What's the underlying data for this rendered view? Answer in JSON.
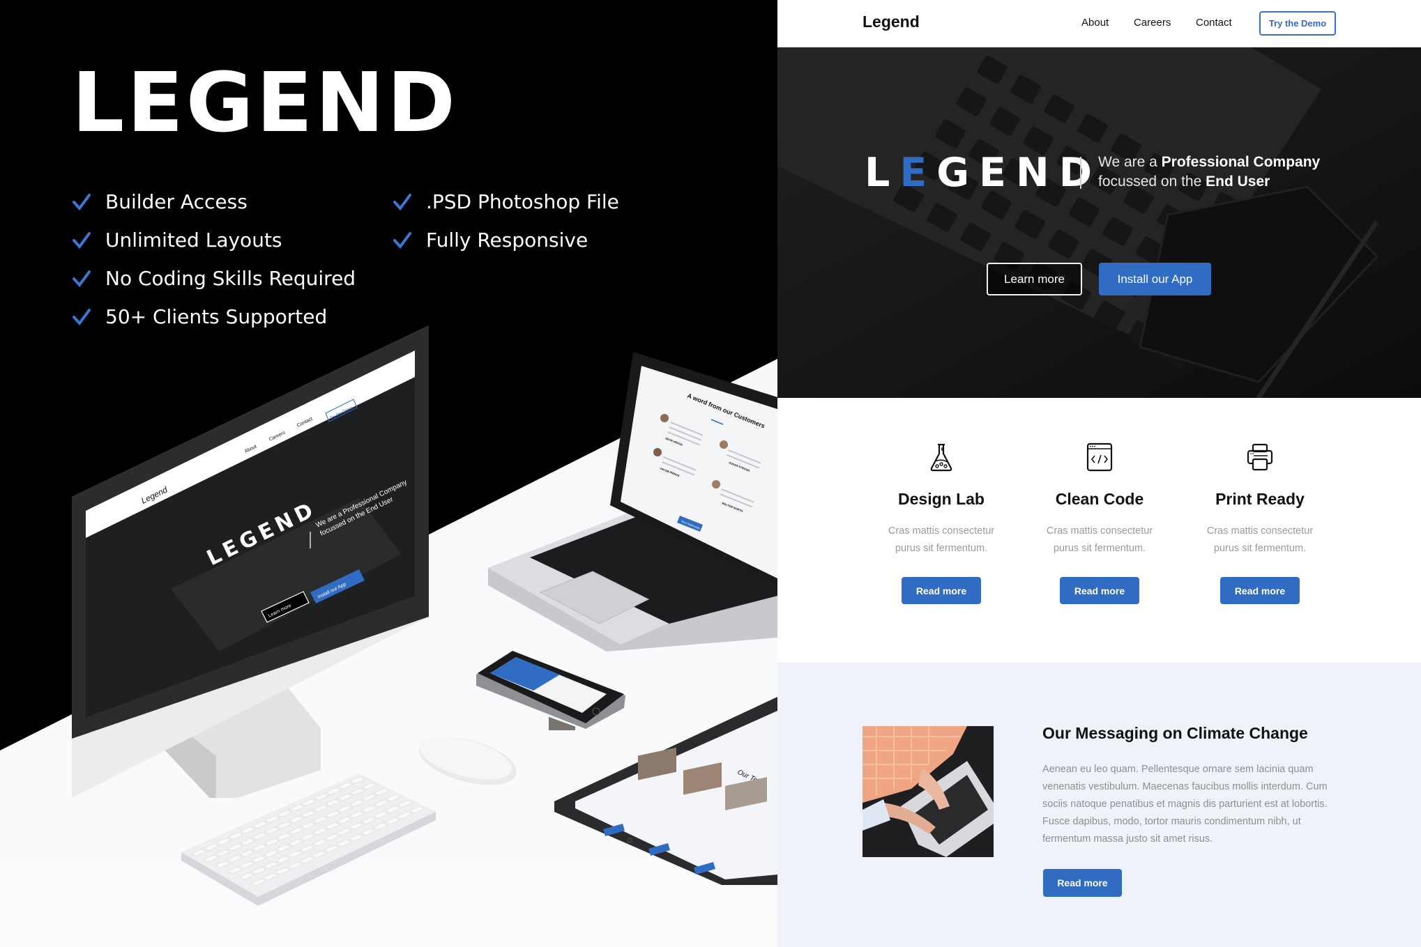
{
  "promo": {
    "title": "LEGEND",
    "features_col1": [
      "Builder Access",
      "Unlimited Layouts",
      "No Coding Skills Required",
      "50+ Clients Supported"
    ],
    "features_col2": [
      ".PSD Photoshop File",
      "Fully Responsive"
    ],
    "check_icon": "checkmark-icon",
    "devices": {
      "imac_screen": {
        "logo": "Legend",
        "nav": [
          "About",
          "Careers",
          "Contact"
        ],
        "demo_button": "Try the Demo",
        "wordmark": "LEGEND",
        "tagline_line1": "We are a Professional Company",
        "tagline_line2": "focussed on the End User",
        "btn_learn": "Learn more",
        "btn_install": "Install our App"
      },
      "laptop_screen": {
        "heading": "A word from our Customers",
        "names": [
          "SEAN HEDGE",
          "SUSAN STRONG",
          "JACOB PRINCE",
          "WALTER NORTH"
        ],
        "button": "More Testimonials"
      },
      "tablet_screen": {
        "heading": "Our Team"
      }
    }
  },
  "site": {
    "nav": {
      "logo": "Legend",
      "links": [
        "About",
        "Careers",
        "Contact"
      ],
      "demo_button": "Try the Demo"
    },
    "hero": {
      "wordmark_first": "L",
      "wordmark_accent": "E",
      "wordmark_rest": "GEND",
      "tagline_prefix1": "We are a ",
      "tagline_bold1": "Professional Company",
      "tagline_prefix2": "focussed on the ",
      "tagline_bold2": "End User",
      "learn_more": "Learn more",
      "install_app": "Install our App"
    },
    "features": [
      {
        "icon": "flask-icon",
        "title": "Design Lab",
        "line1": "Cras mattis consectetur",
        "line2": "purus sit fermentum.",
        "button": "Read more"
      },
      {
        "icon": "code-window-icon",
        "title": "Clean Code",
        "line1": "Cras mattis consectetur",
        "line2": "purus sit fermentum.",
        "button": "Read more"
      },
      {
        "icon": "printer-icon",
        "title": "Print Ready",
        "line1": "Cras mattis consectetur",
        "line2": "purus sit fermentum.",
        "button": "Read more"
      }
    ],
    "climate": {
      "title": "Our Messaging on Climate Change",
      "body": "Aenean eu leo quam. Pellentesque ornare sem lacinia quam venenatis vestibulum. Maecenas faucibus mollis interdum. Cum sociis natoque penatibus et magnis dis parturient est at lobortis. Fusce dapibus, modo, tortor mauris condimentum nibh, ut fermentum massa justo sit amet risus.",
      "button": "Read more",
      "image": "person-typing-on-laptop-photo"
    }
  },
  "colors": {
    "accent_blue": "#2f6cc2",
    "promo_bg": "#000000",
    "climate_bg": "#eff2f9",
    "muted_text": "#9a9a9a"
  }
}
